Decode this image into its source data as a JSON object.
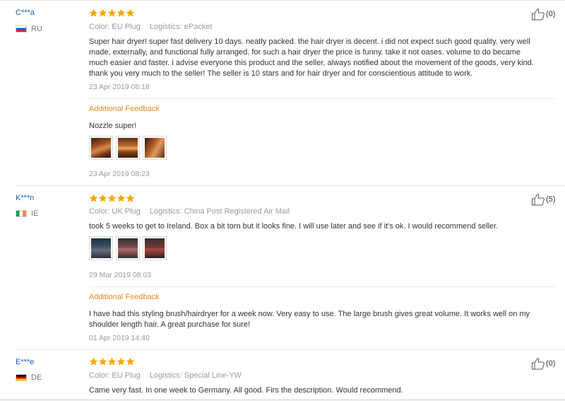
{
  "reviews": [
    {
      "user": "C***a",
      "country": "RU",
      "flag_icon": "russia-flag-icon",
      "stars": 5,
      "color": "Color: EU Plug",
      "logistics": "Logistics: ePacket",
      "text": "Super hair dryer! super fast delivery 10 days. neatly packed. the hair dryer is decent. i did not expect such good quality. very well made, externally, and functional fully arranged. for such a hair dryer the price is funny. take it not oases. volume to do became much easier and faster. i advise everyone this product and the seller, always notified about the movement of the goods, very kind. thank you very much to the seller! The seller is 10 stars and for hair dryer and for conscientious attitude to work.",
      "date": "23 Apr 2019 08:18",
      "helpful_count": "(0)",
      "additional": {
        "label": "Additional Feedback",
        "text": "Nozzle super!",
        "date": "23 Apr 2019 08:23"
      }
    },
    {
      "user": "K***n",
      "country": "IE",
      "flag_icon": "ireland-flag-icon",
      "stars": 5,
      "color": "Color: UK Plug",
      "logistics": "Logistics: China Post Registered Air Mail",
      "text": "took 5 weeks to get to Ireland. Box a bit torn but it looks fine. I will use later and see if it's ok. I would recommend seller.",
      "date": "29 Mar 2019 08:03",
      "helpful_count": "(5)",
      "additional": {
        "label": "Additional Feedback",
        "text": "I have had this styling brush/hairdryer for a week now. Very easy to use. The large brush gives great volume. It works well on my shoulder length hair. A great purchase for sure!",
        "date": "01 Apr 2019 14:40"
      }
    },
    {
      "user": "E***e",
      "country": "DE",
      "flag_icon": "germany-flag-icon",
      "stars": 5,
      "color": "Color: EU Plug",
      "logistics": "Logistics: Special Line-YW",
      "text": "Came very fast. In one week to Germany. All good. Firs the description. Would recommend.",
      "helpful_count": "(0)"
    }
  ],
  "colors": {
    "star": "#f7a600",
    "username": "#1a5fb4",
    "feedback_label": "#e8891e",
    "meta": "#9a9a9a"
  }
}
